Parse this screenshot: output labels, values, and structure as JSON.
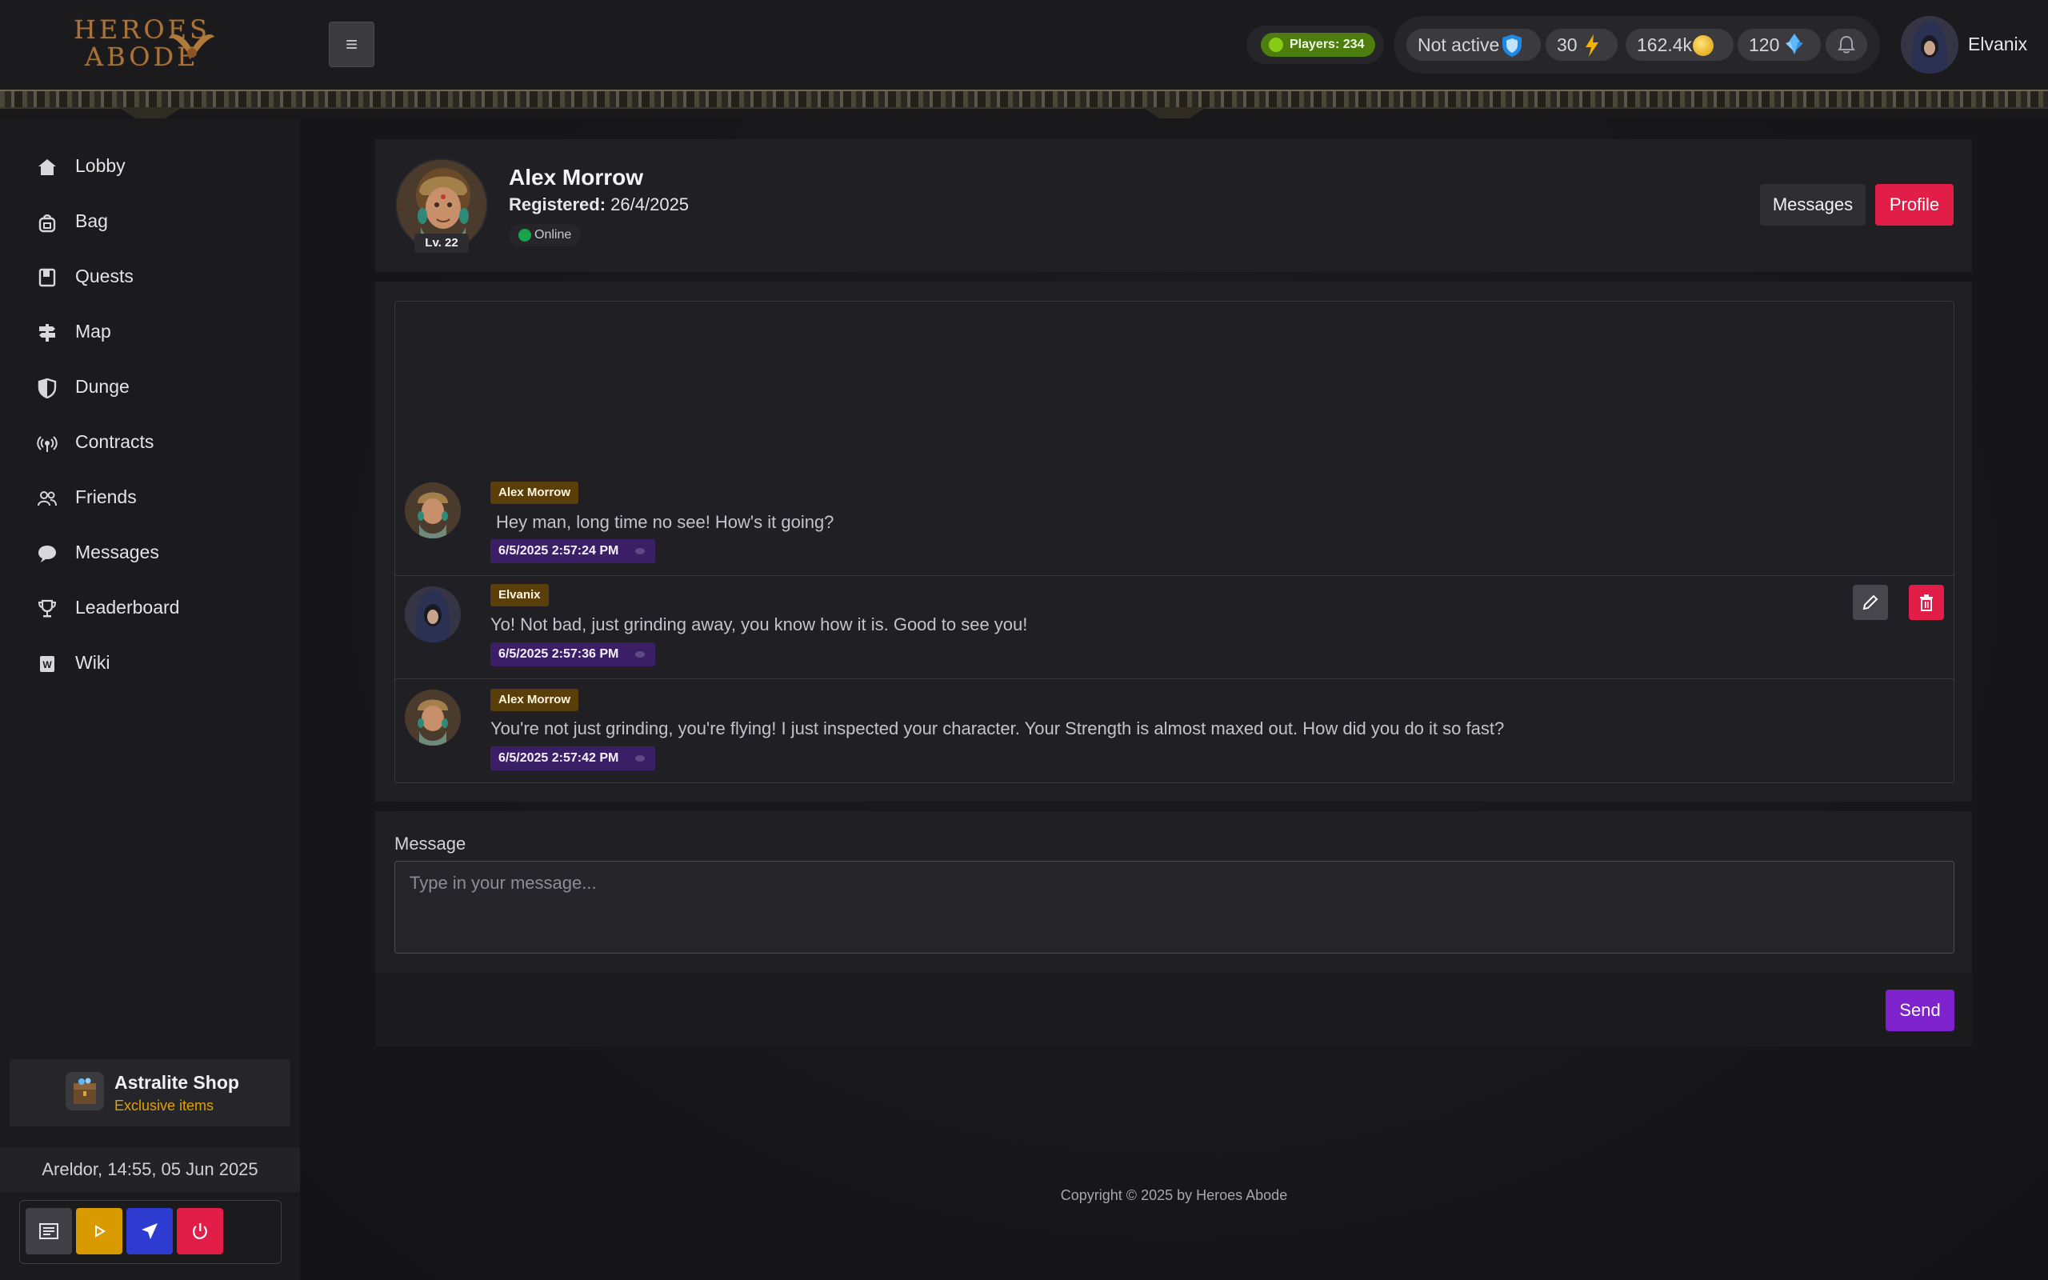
{
  "header": {
    "logo_line1": "HEROES",
    "logo_line2": "ABODE",
    "menu_toggle_icon": "hamburger-icon",
    "players_label": "Players: 234",
    "status_label": "Not active",
    "energy_value": "30",
    "gold_value": "162.4k",
    "crystal_value": "120",
    "user_name": "Elvanix"
  },
  "sidebar": {
    "items": [
      {
        "label": "Lobby",
        "icon": "home-icon"
      },
      {
        "label": "Bag",
        "icon": "bag-icon"
      },
      {
        "label": "Quests",
        "icon": "book-icon"
      },
      {
        "label": "Map",
        "icon": "signpost-icon"
      },
      {
        "label": "Dunge",
        "icon": "shield-icon"
      },
      {
        "label": "Contracts",
        "icon": "broadcast-icon"
      },
      {
        "label": "Friends",
        "icon": "people-icon"
      },
      {
        "label": "Messages",
        "icon": "chat-icon"
      },
      {
        "label": "Leaderboard",
        "icon": "trophy-icon"
      },
      {
        "label": "Wiki",
        "icon": "wiki-icon"
      }
    ],
    "shop": {
      "title": "Astralite Shop",
      "subtitle": "Exclusive items"
    },
    "clock": "Areldor, 14:55, 05 Jun 2025"
  },
  "profile": {
    "name": "Alex Morrow",
    "registered_label": "Registered:",
    "registered_date": "26/4/2025",
    "level": "Lv. 22",
    "status": "Online",
    "messages_button": "Messages",
    "profile_button": "Profile"
  },
  "messages": [
    {
      "author": "Alex Morrow",
      "text": "Hey man, long time no see! How's it going?",
      "time": "6/5/2025 2:57:24 PM"
    },
    {
      "author": "Elvanix",
      "text": "Yo! Not bad, just grinding away, you know how it is. Good to see you!",
      "time": "6/5/2025 2:57:36 PM"
    },
    {
      "author": "Alex Morrow",
      "text": "You're not just grinding, you're flying! I just inspected your character. Your Strength is almost maxed out. How did you do it so fast?",
      "time": "6/5/2025 2:57:42 PM"
    }
  ],
  "form": {
    "label": "Message",
    "placeholder": "Type in your message...",
    "send_label": "Send"
  },
  "footer": {
    "copyright": "Copyright © 2025 by Heroes Abode"
  },
  "colors": {
    "accent_red": "#e11d48",
    "accent_purple": "#7e22ce",
    "players_green": "#4d7c0f",
    "name_tag": "#5a3f0a",
    "time_tag": "#3b1f66"
  }
}
